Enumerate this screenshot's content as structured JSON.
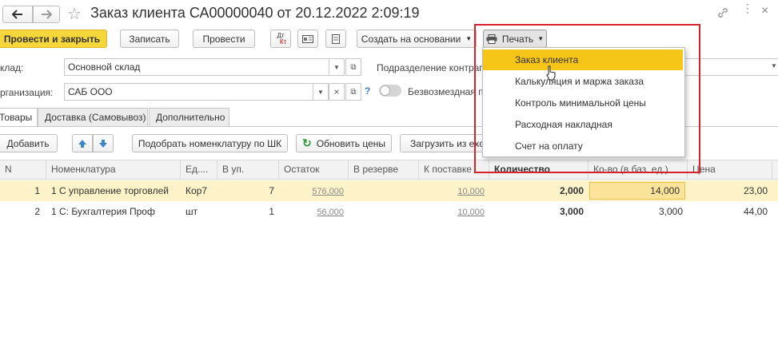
{
  "window": {
    "title": "Заказ клиента СА00000040 от 20.12.2022 2:09:19"
  },
  "toolbar": {
    "post_close": "Провести и закрыть",
    "save": "Записать",
    "post": "Провести",
    "dt_kt_top": "Дт",
    "dt_kt_bottom": "Кт",
    "create_based": "Создать на основании",
    "print": "Печать"
  },
  "form": {
    "warehouse_label": "клад:",
    "warehouse_value": "Основной склад",
    "division_label": "Подразделение контраге",
    "org_label": "рганизация:",
    "org_value": "САБ ООО",
    "free_toggle_label": "Безвозмездная п",
    "help": "?"
  },
  "tabs": [
    {
      "label": "Товары"
    },
    {
      "label": "Доставка (Самовывоз)"
    },
    {
      "label": "Дополнительно"
    }
  ],
  "table_toolbar": {
    "add": "Добавить",
    "pick_barcode": "Подобрать номенклатуру по ШК",
    "refresh_prices": "Обновить цены",
    "load_from": "Загрузить из exc"
  },
  "table": {
    "columns": [
      "N",
      "Номенклатура",
      "Ед....",
      "В уп.",
      "Остаток",
      "В резерве",
      "К поставке",
      "Количество",
      "Ко-во (в баз. ед.)",
      "Цена"
    ],
    "rows": [
      {
        "n": "1",
        "name": "1 С управление торговлей",
        "unit": "Кор7",
        "pack": "7",
        "stock": "576,000",
        "reserve": "",
        "to_ship": "10,000",
        "qty": "2,000",
        "qty_base": "14,000",
        "price": "23,00"
      },
      {
        "n": "2",
        "name": "1 С:  Бухгалтерия Проф",
        "unit": "шт",
        "pack": "1",
        "stock": "56,000",
        "reserve": "",
        "to_ship": "10,000",
        "qty": "3,000",
        "qty_base": "3,000",
        "price": "44,00"
      }
    ]
  },
  "print_menu": {
    "items": [
      {
        "label": "Заказ клиента"
      },
      {
        "label": "Калькуляция и маржа заказа"
      },
      {
        "label": "Контроль минимальной цены"
      },
      {
        "label": "Расходная накладная"
      },
      {
        "label": "Счет на оплату"
      }
    ]
  },
  "colors": {
    "accent_yellow": "#f5d63b",
    "highlight_row": "#fdf2c8",
    "menu_selected": "#f5c518",
    "annotation_red": "#d6222a"
  }
}
